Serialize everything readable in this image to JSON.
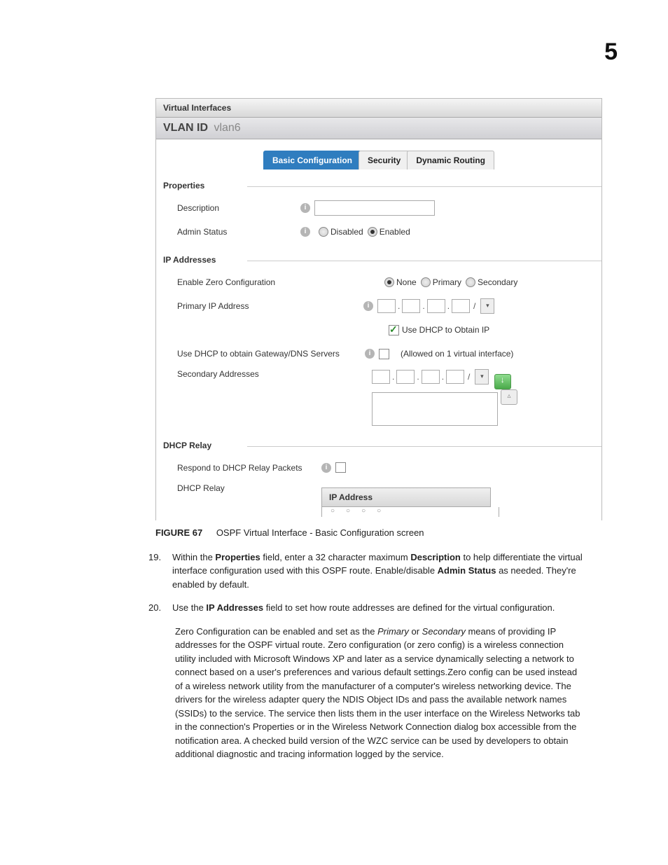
{
  "page_number": "5",
  "panel": {
    "title": "Virtual Interfaces",
    "vlan_label": "VLAN ID",
    "vlan_value": "vlan6",
    "tabs": {
      "basic": "Basic Configuration",
      "security": "Security",
      "routing": "Dynamic Routing"
    }
  },
  "sections": {
    "properties": {
      "heading": "Properties",
      "description_label": "Description",
      "admin_status_label": "Admin Status",
      "disabled": "Disabled",
      "enabled": "Enabled"
    },
    "ip": {
      "heading": "IP Addresses",
      "zero_conf": "Enable Zero Configuration",
      "none": "None",
      "primary": "Primary",
      "secondary": "Secondary",
      "primary_ip": "Primary IP Address",
      "use_dhcp_ip": "Use DHCP to Obtain IP",
      "use_dhcp_gw": "Use DHCP to obtain Gateway/DNS Servers",
      "allowed_note": "(Allowed on 1 virtual interface)",
      "secondary_addresses": "Secondary Addresses"
    },
    "relay": {
      "heading": "DHCP Relay",
      "respond": "Respond to DHCP Relay Packets",
      "dhcp_relay": "DHCP Relay",
      "table_head": "IP Address"
    }
  },
  "caption": {
    "label": "FIGURE 67",
    "text": "OSPF Virtual Interface - Basic Configuration screen"
  },
  "steps": {
    "s19_num": "19.",
    "s19_a": "Within the ",
    "s19_b": "Properties",
    "s19_c": " field, enter a 32 character maximum ",
    "s19_d": "Description",
    "s19_e": " to help differentiate the virtual interface configuration used with this OSPF route. Enable/disable ",
    "s19_f": "Admin Status",
    "s19_g": " as needed. They're enabled by default.",
    "s20_num": "20.",
    "s20_a": "Use the ",
    "s20_b": "IP Addresses",
    "s20_c": " field to set how route addresses are defined for the virtual configuration."
  },
  "para": {
    "p1a": "Zero Configuration can be enabled and set as the ",
    "p1b": "Primary",
    "p1c": " or ",
    "p1d": "Secondary",
    "p1e": " means of providing IP addresses for the OSPF virtual route. Zero configuration (or zero config) is a wireless connection utility included with Microsoft Windows XP and later as a service dynamically selecting a network to connect based on a user's preferences and various default settings.Zero config can be used instead of a wireless network utility from the manufacturer of a computer's wireless networking device. The drivers for the wireless adapter query the NDIS Object IDs and pass the available network names (SSIDs) to the service. The service then lists them in the user interface on the Wireless Networks tab in the connection's Properties or in the Wireless Network Connection dialog box accessible from the notification area. A checked build version of the WZC service can be used by developers to obtain additional diagnostic and tracing information logged by the service."
  }
}
